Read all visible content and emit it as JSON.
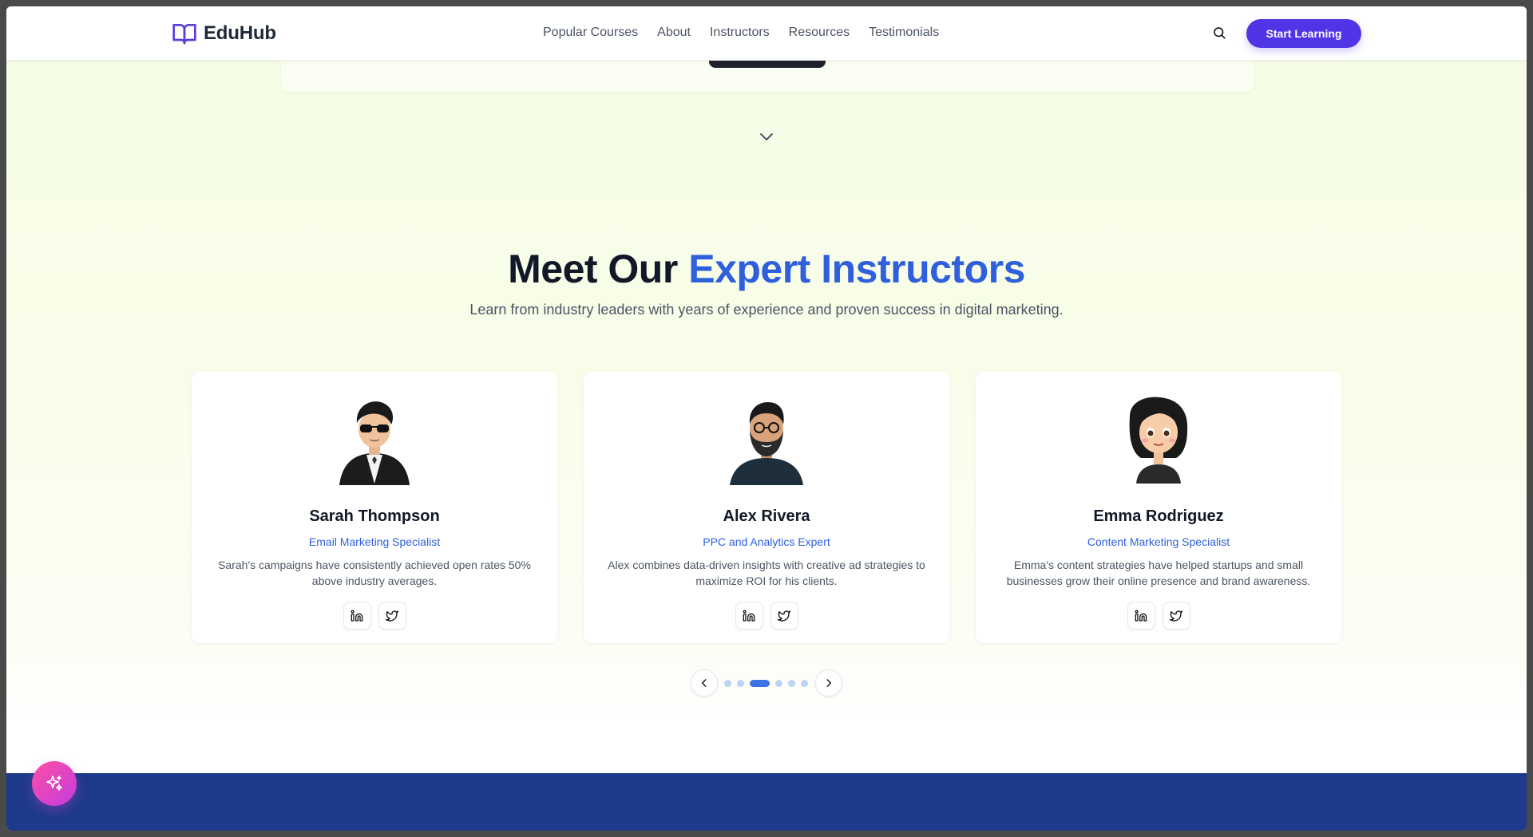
{
  "header": {
    "brand": "EduHub",
    "nav": [
      "Popular Courses",
      "About",
      "Instructors",
      "Resources",
      "Testimonials"
    ],
    "cta_label": "Start Learning"
  },
  "section": {
    "title_main": "Meet Our",
    "title_accent": "Expert Instructors",
    "subtitle": "Learn from industry leaders with years of experience and proven success in digital marketing."
  },
  "instructors": [
    {
      "name": "Sarah Thompson",
      "role": "Email Marketing Specialist",
      "bio": "Sarah's campaigns have consistently achieved open rates 50% above industry averages."
    },
    {
      "name": "Alex Rivera",
      "role": "PPC and Analytics Expert",
      "bio": "Alex combines data-driven insights with creative ad strategies to maximize ROI for his clients."
    },
    {
      "name": "Emma Rodriguez",
      "role": "Content Marketing Specialist",
      "bio": "Emma's content strategies have helped startups and small businesses grow their online presence and brand awareness."
    }
  ],
  "carousel": {
    "total_slides": 6,
    "active_index": 2
  },
  "colors": {
    "accent": "#2f5fdd",
    "cta": "#4f35e6",
    "footer": "#1e3a8a",
    "dot_active": "#3b74e6"
  }
}
